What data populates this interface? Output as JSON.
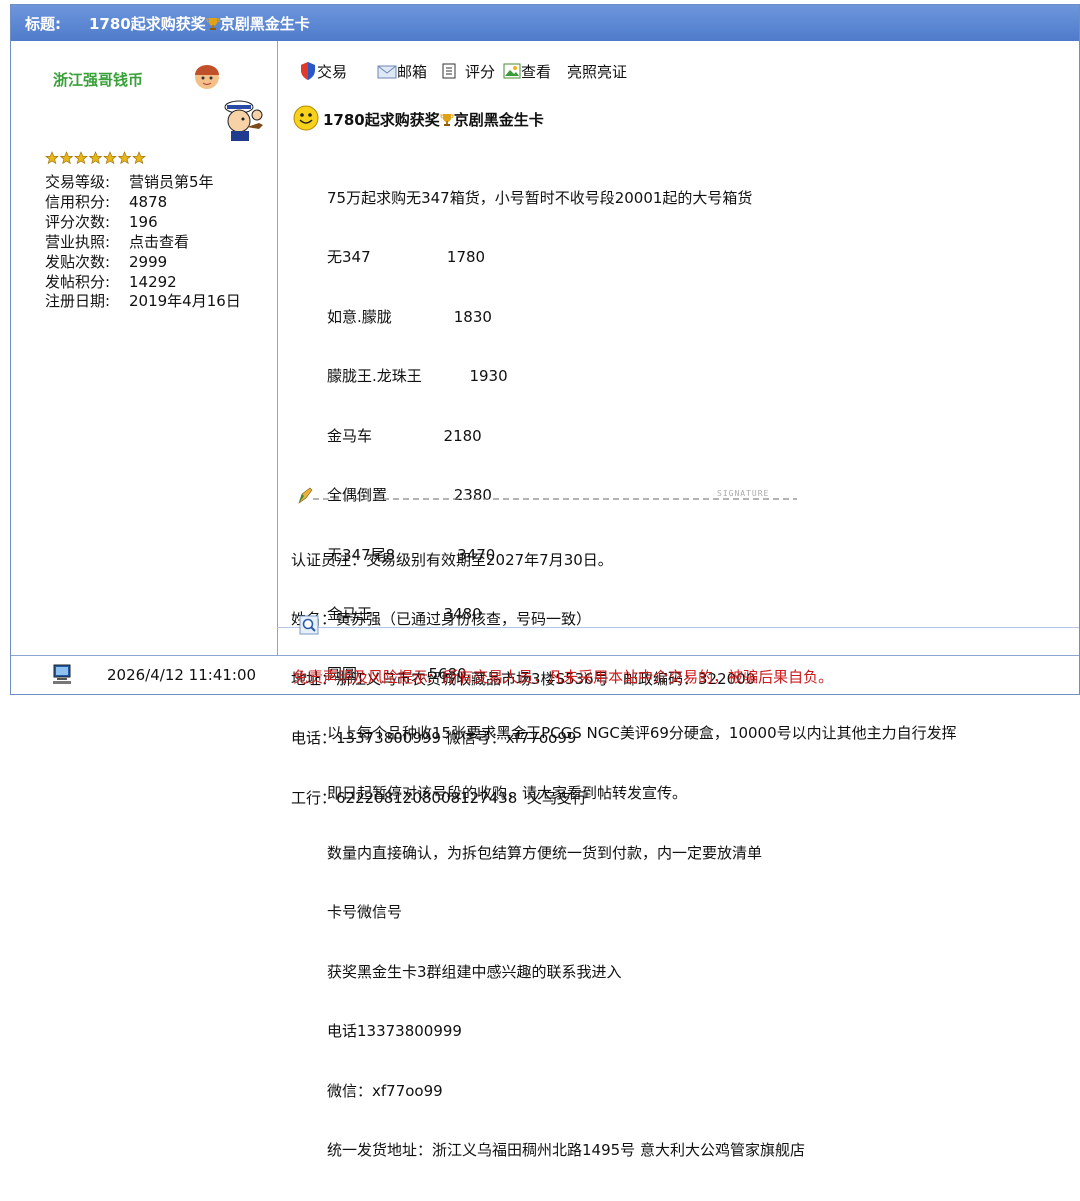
{
  "header": {
    "label": "标题:",
    "title_pre": "1780起求购获奖",
    "title_post": "京剧黑金生卡"
  },
  "sidebar": {
    "username": "浙江强哥钱币",
    "stats": [
      {
        "k": "交易等级:",
        "v": "营销员第5年"
      },
      {
        "k": "信用积分:",
        "v": "4878"
      },
      {
        "k": "评分次数:",
        "v": "196"
      },
      {
        "k": "营业执照:",
        "v": "点击查看"
      },
      {
        "k": "发贴次数:",
        "v": "2999"
      },
      {
        "k": "发帖积分:",
        "v": "14292"
      },
      {
        "k": "注册日期:",
        "v": "2019年4月16日"
      }
    ],
    "star_count": 7
  },
  "toolbar": {
    "trade": "交易",
    "mail": "邮箱",
    "rate": "评分",
    "view": "查看",
    "license": "亮照亮证"
  },
  "post": {
    "title_pre": "1780起求购获奖",
    "title_post": "京剧黑金生卡",
    "lines": [
      "75万起求购无347箱货，小号暂时不收号段20001起的大号箱货",
      "无347                1780",
      "如意.朦胧             1830",
      "朦胧王.龙珠王          1930",
      "金马车               2180",
      "全偶倒置              2380",
      "无347尾8             3470",
      "金马王               3480",
      "圆圆               5680",
      "以上每个品种收15张要求黑金王PCGS NGC美评69分硬盒，10000号以内让其他主力自行发挥",
      "即日起暂停对该号段的收购，请大家看到帖转发宣传。",
      "数量内直接确认，为拆包结算方便统一货到付款，内一定要放清单",
      "卡号微信号",
      "获奖黑金生卡3群组建中感兴趣的联系我进入",
      "电话13373800999",
      "微信：xf77oo99",
      "统一发货地址：浙江义乌福田稠州北路1495号 意大利大公鸡管家旗舰店"
    ],
    "signature_word": "SIGNATURE",
    "cert_lines": [
      "认证员注：交易级别有效期至2027年7月30日。",
      "姓名：黄苏强（已通过身份核查，号码一致）",
      "地址：浙江义乌市农贸城收藏品市场3楼S536号   邮政编码：322000",
      "电话：13373800999 微信号：xf77oo99",
      "工行：6222081208008127438  义乌支行"
    ]
  },
  "footer": {
    "datetime": "2026/4/12 11:41:00",
    "disclaimer_label": "免责声明及风险提示:",
    "disclaimer_text": "所有交易人员，凡未采用本站中介交易的，被骗后果自负。"
  },
  "colors": {
    "titlebar": "#5a86d2",
    "username": "#3aa03a",
    "disclaimer": "#cc1b1b",
    "border": "#6f8fc4"
  }
}
